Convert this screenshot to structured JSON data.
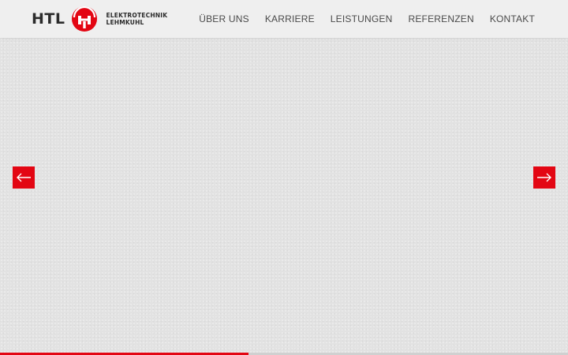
{
  "brand": {
    "short": "HTL",
    "line1": "ELEKTROTECHNIK",
    "line2": "LEHMKUHL",
    "logo_icon": "htl-logo-mark-icon",
    "accent_color": "#e30613"
  },
  "nav": {
    "items": [
      {
        "label": "ÜBER UNS"
      },
      {
        "label": "KARRIERE"
      },
      {
        "label": "LEISTUNGEN"
      },
      {
        "label": "REFERENZEN"
      },
      {
        "label": "KONTAKT"
      }
    ]
  },
  "slider": {
    "prev_icon": "arrow-left-icon",
    "next_icon": "arrow-right-icon",
    "progress_percent": 43.7
  }
}
